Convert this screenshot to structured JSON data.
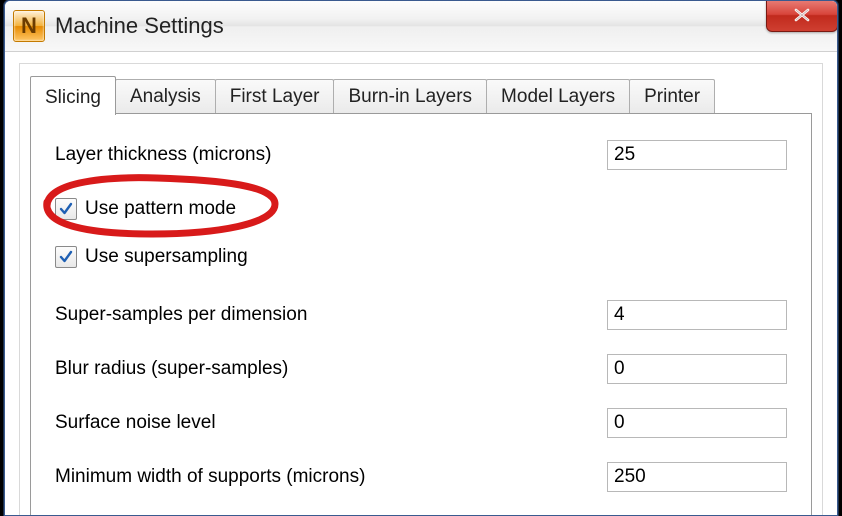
{
  "window": {
    "title": "Machine Settings",
    "icon_letter": "N"
  },
  "tabs": [
    {
      "label": "Slicing",
      "active": true
    },
    {
      "label": "Analysis",
      "active": false
    },
    {
      "label": "First Layer",
      "active": false
    },
    {
      "label": "Burn-in Layers",
      "active": false
    },
    {
      "label": "Model Layers",
      "active": false
    },
    {
      "label": "Printer",
      "active": false
    }
  ],
  "slicing": {
    "layer_thickness_label": "Layer thickness (microns)",
    "layer_thickness_value": "25",
    "use_pattern_mode_label": "Use pattern mode",
    "use_pattern_mode_checked": true,
    "use_supersampling_label": "Use supersampling",
    "use_supersampling_checked": true,
    "super_samples_label": "Super-samples per dimension",
    "super_samples_value": "4",
    "blur_radius_label": "Blur radius (super-samples)",
    "blur_radius_value": "0",
    "surface_noise_label": "Surface noise level",
    "surface_noise_value": "0",
    "min_support_width_label": "Minimum width of supports (microns)",
    "min_support_width_value": "250"
  }
}
